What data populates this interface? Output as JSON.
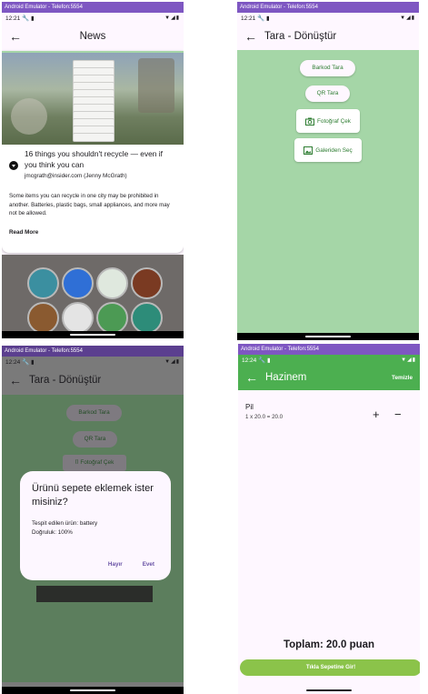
{
  "emulator_title": "Android Emulator - Telefon:5554",
  "screens": [
    {
      "time": "12:21",
      "title": "News",
      "article": {
        "headline": "16 things you shouldn't recycle — even if you think you can",
        "author": "jmcgrath@insider.com (Jenny McGrath)",
        "body": "Some items you can recycle in one city may be prohibited in another. Batteries, plastic bags, small appliances, and more may not be allowed.",
        "read_more": "Read More"
      }
    },
    {
      "time": "12:21",
      "title": "Tara - Dönüştür",
      "barcode": "Barkod Tara",
      "qr": "QR Tara",
      "photo": "Fotoğraf Çek",
      "gallery": "Galeriden Seç"
    },
    {
      "time": "12:24",
      "title": "Tara - Dönüştür",
      "barcode": "Barkod Tara",
      "qr": "QR Tara",
      "photo": "Fotoğraf Çek",
      "dialog": {
        "title": "Ürünü sepete eklemek ister misiniz?",
        "line1": "Tespit edilen ürün: battery",
        "line2": "Doğruluk: 100%",
        "no": "Hayır",
        "yes": "Evet"
      }
    },
    {
      "time": "12:24",
      "title": "Hazinem",
      "clear": "Temizle",
      "item_name": "Pil",
      "item_detail": "1 x 20.0 = 20.0",
      "plus": "+",
      "minus": "−",
      "total": "Toplam: 20.0 puan",
      "checkout": "Tıkla Sepetine Gir!"
    }
  ],
  "colors": {
    "emulator_bar": "#7e57c2",
    "scan_background": "#a5d6a7",
    "cart_appbar": "#4caf50",
    "checkout_button": "#8bc34a"
  },
  "icons": [
    "back-arrow-icon",
    "wrench-icon",
    "sd-card-icon",
    "wifi-icon",
    "signal-icon",
    "battery-icon",
    "camera-icon",
    "gallery-icon",
    "expand-icon"
  ]
}
